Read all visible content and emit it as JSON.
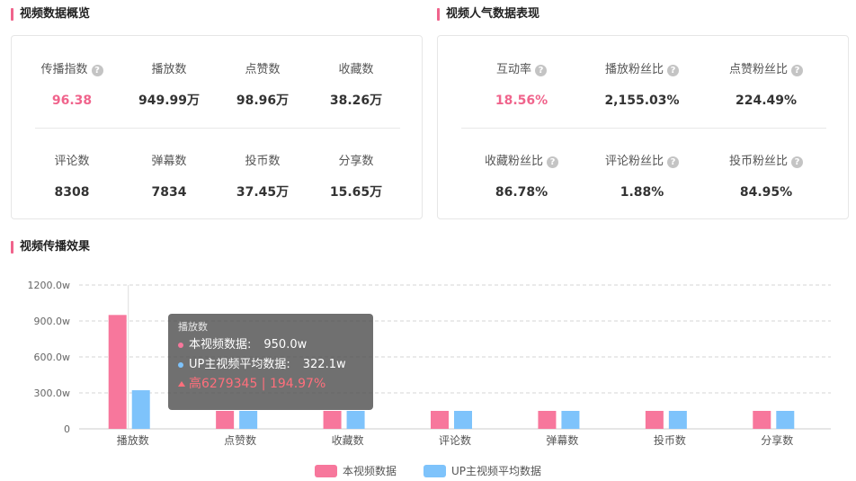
{
  "overview": {
    "title": "视频数据概览",
    "metrics": [
      {
        "label": "传播指数",
        "value": "96.38",
        "help": true,
        "highlight": true
      },
      {
        "label": "播放数",
        "value": "949.99万",
        "help": false,
        "highlight": false
      },
      {
        "label": "点赞数",
        "value": "98.96万",
        "help": false,
        "highlight": false
      },
      {
        "label": "收藏数",
        "value": "38.26万",
        "help": false,
        "highlight": false
      },
      {
        "label": "评论数",
        "value": "8308",
        "help": false,
        "highlight": false
      },
      {
        "label": "弹幕数",
        "value": "7834",
        "help": false,
        "highlight": false
      },
      {
        "label": "投币数",
        "value": "37.45万",
        "help": false,
        "highlight": false
      },
      {
        "label": "分享数",
        "value": "15.65万",
        "help": false,
        "highlight": false
      }
    ]
  },
  "popularity": {
    "title": "视频人气数据表现",
    "metrics": [
      {
        "label": "互动率",
        "value": "18.56%",
        "help": true,
        "highlight": true
      },
      {
        "label": "播放粉丝比",
        "value": "2,155.03%",
        "help": true,
        "highlight": false
      },
      {
        "label": "点赞粉丝比",
        "value": "224.49%",
        "help": true,
        "highlight": false
      },
      {
        "label": "收藏粉丝比",
        "value": "86.78%",
        "help": true,
        "highlight": false
      },
      {
        "label": "评论粉丝比",
        "value": "1.88%",
        "help": true,
        "highlight": false
      },
      {
        "label": "投币粉丝比",
        "value": "84.95%",
        "help": true,
        "highlight": false
      }
    ]
  },
  "effect": {
    "title": "视频传播效果"
  },
  "help_glyph": "?",
  "chart_data": {
    "type": "bar",
    "categories": [
      "播放数",
      "点赞数",
      "收藏数",
      "评论数",
      "弹幕数",
      "投币数",
      "分享数"
    ],
    "series": [
      {
        "name": "本视频数据",
        "color": "#f7779c",
        "values": [
          950.0,
          98.96,
          38.26,
          0.8308,
          0.7834,
          37.45,
          15.65
        ]
      },
      {
        "name": "UP主视频平均数据",
        "color": "#7ec3fb",
        "values": [
          322.1,
          30.0,
          12.0,
          0.5,
          0.5,
          10.0,
          5.0
        ]
      }
    ],
    "y_ticks": [
      "0",
      "300.0w",
      "600.0w",
      "900.0w",
      "1200.0w"
    ],
    "ylim": [
      0,
      1200
    ],
    "grid": true,
    "legend_position": "bottom-center"
  },
  "tooltip": {
    "title": "播放数",
    "row1_label": "本视频数据:",
    "row1_value": "950.0w",
    "row2_label": "UP主视频平均数据:",
    "row2_value": "322.1w",
    "high_text": "高6279345 | 194.97%"
  },
  "colors": {
    "accent": "#f0648c",
    "series1": "#f7779c",
    "series2": "#7ec3fb"
  }
}
